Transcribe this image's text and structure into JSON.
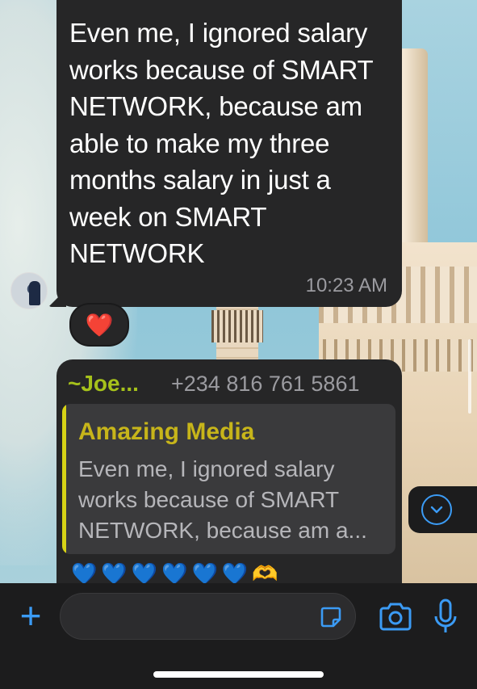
{
  "messages": [
    {
      "text": "Even me, I ignored salary works because of SMART NETWORK, because am able to make my three months salary in just a week on SMART NETWORK",
      "time": "10:23 AM",
      "reaction": "❤️"
    },
    {
      "sender": "~Joe...",
      "phone": "+234 816 761 5861",
      "quote": {
        "author": "Amazing Media",
        "text": "Even me, I ignored salary works because of SMART NETWORK, because am a..."
      },
      "emojis": "💙💙💙💙💙💙",
      "hands": "🫶"
    }
  ],
  "composer": {
    "placeholder": "",
    "icons": [
      "plus-icon",
      "sticker-icon",
      "camera-icon",
      "microphone-icon"
    ]
  },
  "colors": {
    "accent": "#3b9bf5",
    "bubble": "#262627",
    "sender": "#a6c21b",
    "quote_author": "#c7b51a"
  }
}
